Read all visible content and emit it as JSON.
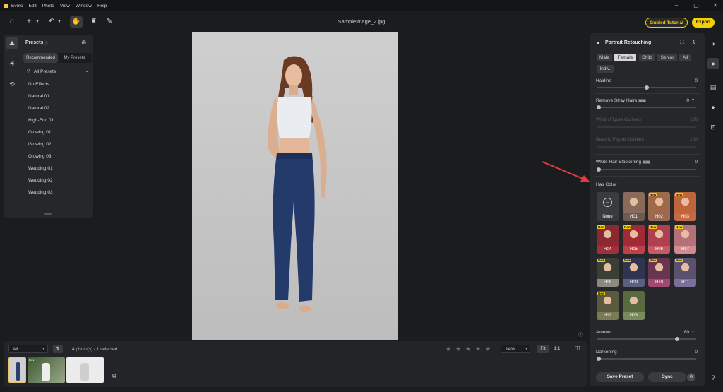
{
  "menubar": {
    "app_name": "Evoto",
    "items": [
      "Edit",
      "Photo",
      "View",
      "Window",
      "Help"
    ]
  },
  "toolbar": {
    "doc_title": "SampleImage_2.jpg",
    "guided_tutorial": "Guided Tutorial",
    "export": "Export",
    "icons": [
      "home-icon",
      "add-icon",
      "undo-icon",
      "hand-icon",
      "stamp-icon",
      "brush-icon"
    ]
  },
  "presets": {
    "title": "Presets",
    "tab_recommended": "Recommended",
    "tab_my_presets": "My Presets",
    "filter_label": "All Presets",
    "items": [
      "No Effects",
      "Natural 01",
      "Natural 02",
      "High-End 01",
      "Glowing 01",
      "Glowing 02",
      "Glowing 03",
      "Wedding 01",
      "Wedding 02",
      "Wedding 03"
    ]
  },
  "filmstrip": {
    "filter_value": "All",
    "status": "4 photo(s) / 1 selected",
    "zoom": "14%",
    "fit": "Fit",
    "one_to_one": "1:1",
    "thumb_badge": "Eovt"
  },
  "retouch": {
    "title": "Portrait Retouching",
    "gender_tabs": [
      "Male",
      "Female",
      "Child",
      "Senior",
      "All",
      "Indiv."
    ],
    "active_tab": "Female",
    "hairline_label": "Hairline",
    "hairline_value": "0",
    "stray_label": "Remove Stray Hairs",
    "stray_badge": "Beta",
    "stray_value": "0",
    "within_outline_label": "Within Figure Outlines",
    "within_outline_value": "100",
    "beyond_outline_label": "Beyond Figure Outlines",
    "beyond_outline_value": "100",
    "blackening_label": "White Hair Blackening",
    "blackening_badge": "Beta",
    "blackening_value": "0",
    "hair_color_label": "Hair Color",
    "none_label": "None",
    "swatches": [
      {
        "label": "H01",
        "color": "#8a6a5a",
        "bar": "#6d5a50",
        "is_new": false
      },
      {
        "label": "H02",
        "color": "#a06a4a",
        "bar": "#9a6a55",
        "is_new": true
      },
      {
        "label": "H03",
        "color": "#c0643a",
        "bar": "#c46a45",
        "is_new": true
      },
      {
        "label": "H04",
        "color": "#8a2a30",
        "bar": "#a0303a",
        "is_new": true
      },
      {
        "label": "H05",
        "color": "#a02a35",
        "bar": "#c0404a",
        "is_new": true
      },
      {
        "label": "H06",
        "color": "#b04050",
        "bar": "#c55a65",
        "is_new": true
      },
      {
        "label": "H07",
        "color": "#b5707a",
        "bar": "#d08a90",
        "is_new": true
      },
      {
        "label": "H08",
        "color": "#3a3f35",
        "bar": "#8a8a80",
        "is_new": true
      },
      {
        "label": "H09",
        "color": "#2f3550",
        "bar": "#5a6080",
        "is_new": true
      },
      {
        "label": "H10",
        "color": "#6a3550",
        "bar": "#a04a70",
        "is_new": true
      },
      {
        "label": "H11",
        "color": "#5a5070",
        "bar": "#7a709a",
        "is_new": true
      },
      {
        "label": "H12",
        "color": "#5a5a40",
        "bar": "#7a7a55",
        "is_new": true
      },
      {
        "label": "H13",
        "color": "#5a6a40",
        "bar": "#7a8a5a",
        "is_new": false
      }
    ],
    "amount_label": "Amount",
    "amount_value": "80",
    "darkening_label": "Darkening",
    "darkening_value": "0",
    "save_preset": "Save Preset",
    "sync": "Sync"
  },
  "colors": {
    "accent_yellow": "#f5d100",
    "arrow_red": "#e53945"
  }
}
